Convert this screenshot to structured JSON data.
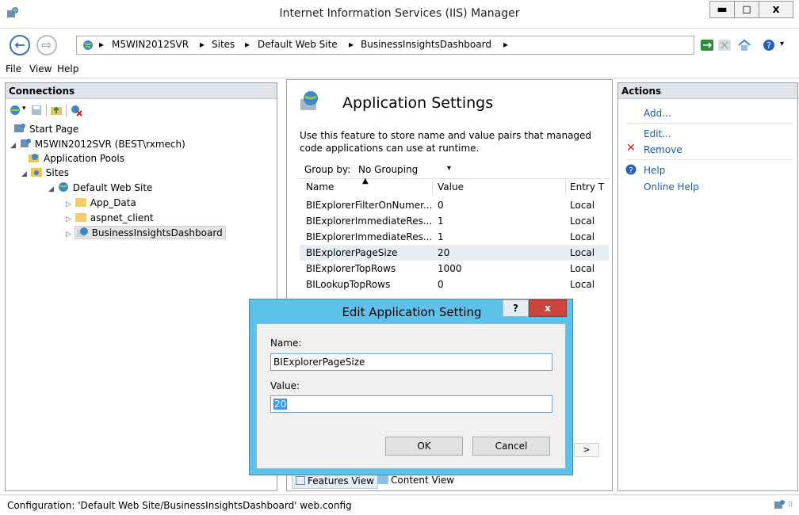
{
  "window": {
    "title": "Internet Information Services (IIS) Manager"
  },
  "caption_buttons": {
    "minimize": "▬",
    "maximize": "◻",
    "close": "x"
  },
  "address": {
    "crumbs": [
      "M5WIN2012SVR",
      "Sites",
      "Default Web Site",
      "BusinessInsightsDashboard"
    ]
  },
  "menu": {
    "file": "File",
    "view": "View",
    "help": "Help"
  },
  "connections": {
    "title": "Connections",
    "tree": [
      {
        "label": "Start Page"
      },
      {
        "label": "M5WIN2012SVR (BEST\\rxmech)"
      },
      {
        "label": "Application Pools"
      },
      {
        "label": "Sites"
      },
      {
        "label": "Default Web Site"
      },
      {
        "label": "App_Data"
      },
      {
        "label": "aspnet_client"
      },
      {
        "label": "BusinessInsightsDashboard"
      }
    ]
  },
  "center": {
    "title": "Application Settings",
    "description_line1": "Use this feature to store name and value pairs that managed",
    "description_line2": "code applications can use at runtime.",
    "group_by_label": "Group by:",
    "group_by_value": "No Grouping",
    "columns": {
      "name": "Name",
      "value": "Value",
      "entry": "Entry T"
    },
    "rows": [
      {
        "name": "BIExplorerFilterOnNumer...",
        "value": "0",
        "entry": "Local"
      },
      {
        "name": "BIExplorerImmediateRes...",
        "value": "1",
        "entry": "Local"
      },
      {
        "name": "BIExplorerImmediateRes...",
        "value": "1",
        "entry": "Local"
      },
      {
        "name": "BIExplorerPageSize",
        "value": "20",
        "entry": "Local"
      },
      {
        "name": "BIExplorerTopRows",
        "value": "1000",
        "entry": "Local"
      },
      {
        "name": "BILookupTopRows",
        "value": "0",
        "entry": "Local"
      }
    ],
    "features_view": "Features View",
    "content_view": "Content View"
  },
  "actions": {
    "title": "Actions",
    "add": "Add...",
    "edit": "Edit...",
    "remove": "Remove",
    "help": "Help",
    "online_help": "Online Help"
  },
  "dialog": {
    "title": "Edit Application Setting",
    "help_btn": "?",
    "close_btn": "x",
    "name_label": "Name:",
    "name_value": "BIExplorerPageSize",
    "value_label": "Value:",
    "value_value": "20",
    "ok": "OK",
    "cancel": "Cancel"
  },
  "status": {
    "text": "Configuration: 'Default Web Site/BusinessInsightsDashboard' web.config"
  }
}
